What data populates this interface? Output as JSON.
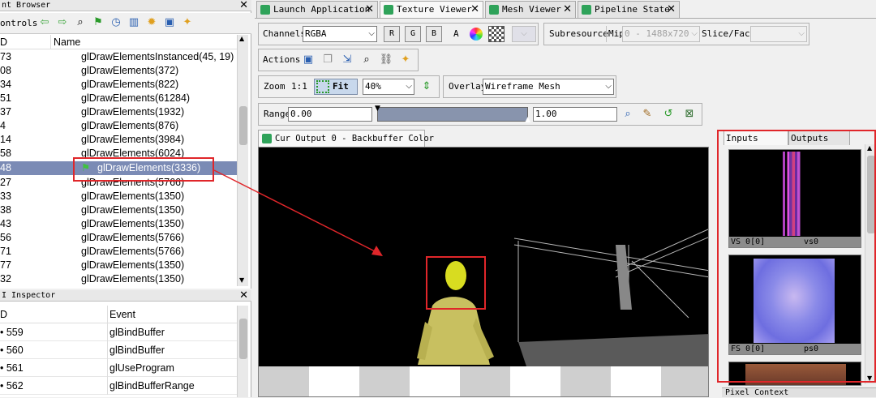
{
  "event_browser": {
    "title": "nt Browser",
    "controls_label": "ontrols",
    "col_id": "D",
    "col_name": "Name",
    "rows": [
      {
        "id": "73",
        "name": "glDrawElementsInstanced(45, 19)"
      },
      {
        "id": "08",
        "name": "glDrawElements(372)"
      },
      {
        "id": "34",
        "name": "glDrawElements(822)"
      },
      {
        "id": "51",
        "name": "glDrawElements(61284)"
      },
      {
        "id": "37",
        "name": "glDrawElements(1932)"
      },
      {
        "id": "4",
        "name": "glDrawElements(876)"
      },
      {
        "id": "14",
        "name": "glDrawElements(3984)"
      },
      {
        "id": "58",
        "name": "glDrawElements(6024)"
      },
      {
        "id": "48",
        "name": "glDrawElements(3336)"
      },
      {
        "id": "27",
        "name": "glDrawElements(5766)"
      },
      {
        "id": "33",
        "name": "glDrawElements(1350)"
      },
      {
        "id": "38",
        "name": "glDrawElements(1350)"
      },
      {
        "id": "43",
        "name": "glDrawElements(1350)"
      },
      {
        "id": "56",
        "name": "glDrawElements(5766)"
      },
      {
        "id": "71",
        "name": "glDrawElements(5766)"
      },
      {
        "id": "77",
        "name": "glDrawElements(1350)"
      },
      {
        "id": "32",
        "name": "glDrawElements(1350)"
      }
    ]
  },
  "api_inspector": {
    "title": "I Inspector",
    "col_id": "D",
    "col_event": "Event",
    "rows": [
      {
        "id": "• 559",
        "event": "glBindBuffer"
      },
      {
        "id": "• 560",
        "event": "glBindBuffer"
      },
      {
        "id": "• 561",
        "event": "glUseProgram"
      },
      {
        "id": "• 562",
        "event": "glBindBufferRange"
      }
    ]
  },
  "tabs": [
    {
      "label": "Launch Application"
    },
    {
      "label": "Texture Viewer"
    },
    {
      "label": "Mesh Viewer"
    },
    {
      "label": "Pipeline State"
    }
  ],
  "toolbar": {
    "channels_label": "Channels",
    "channels_value": "RGBA",
    "r": "R",
    "g": "G",
    "b": "B",
    "a": "A",
    "subresource_label": "Subresource",
    "mip_label": "Mip",
    "mip_value": "0 - 1488x720",
    "slice_label": "Slice/Face",
    "actions_label": "Actions",
    "zoom_label": "Zoom",
    "zoom_1to1": "1:1",
    "fit_label": "Fit",
    "zoom_value": "40%",
    "overlay_label": "Overlay",
    "overlay_value": "Wireframe Mesh",
    "range_label": "Range",
    "range_min": "0.00",
    "range_max": "1.00"
  },
  "output": {
    "tab_label": "Cur Output 0 - Backbuffer Color"
  },
  "side": {
    "tab_inputs": "Inputs",
    "tab_outputs": "Outputs",
    "thumbs": [
      {
        "slot": "VS 0[0]",
        "name": "vs0"
      },
      {
        "slot": "FS 0[0]",
        "name": "ps0"
      }
    ],
    "pixel_context": "Pixel Context"
  },
  "colors": {
    "annotation_red": "#e0262a",
    "selection": "#7b8bb5",
    "tab_icon": "#2fa35a"
  }
}
